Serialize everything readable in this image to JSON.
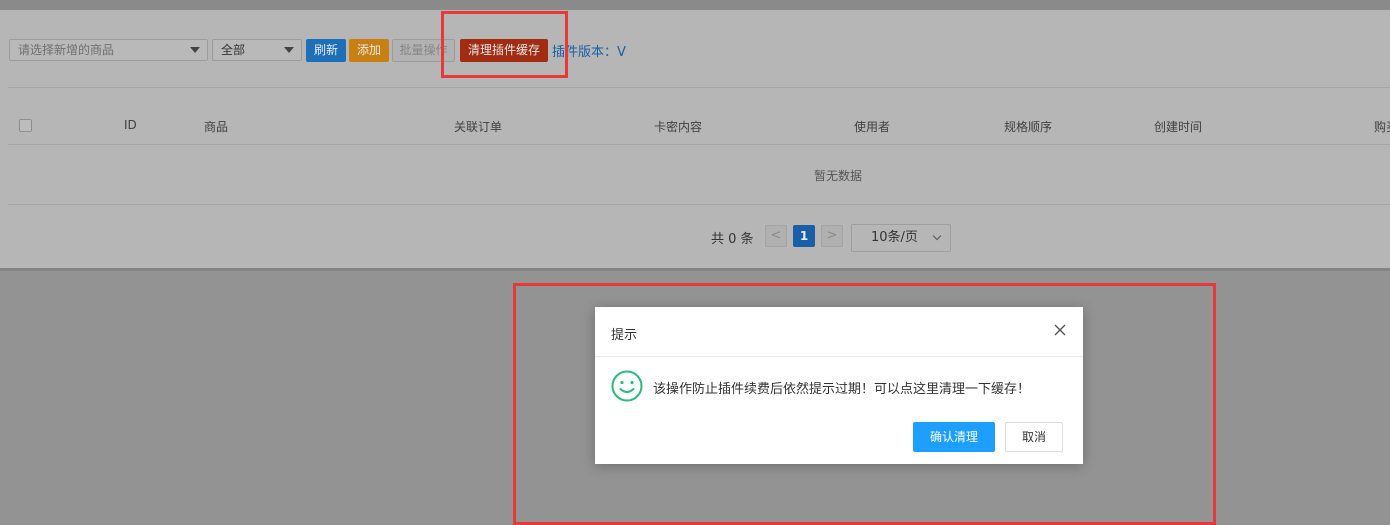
{
  "toolbar": {
    "product_select_placeholder": "请选择新增的商品",
    "status_select_value": "全部",
    "refresh_label": "刷新",
    "add_label": "添加",
    "batch_label": "批量操作",
    "clear_cache_label": "清理插件缓存",
    "version_label": "插件版本：V"
  },
  "table": {
    "headers": [
      "ID",
      "商品",
      "关联订单",
      "卡密内容",
      "使用者",
      "规格顺序",
      "创建时间",
      "购买"
    ],
    "empty_text": "暂无数据"
  },
  "pagination": {
    "total_text": "共 0 条",
    "prev": "<",
    "current_page": "1",
    "next": ">",
    "page_size": "10条/页"
  },
  "dialog": {
    "title": "提示",
    "message": "该操作防止插件续费后依然提示过期！可以点这里清理一下缓存！",
    "confirm_label": "确认清理",
    "cancel_label": "取消"
  },
  "colors": {
    "highlight_border": "#e63a3a",
    "confirm_button": "#1e9fff",
    "clear_cache_button": "#a12c12",
    "refresh_button": "#1d6fb8",
    "add_button": "#c98012",
    "smile_icon": "#2eb87a"
  },
  "icons": [
    "close-icon",
    "smile-icon",
    "caret-down-icon",
    "chevron-down-icon"
  ]
}
